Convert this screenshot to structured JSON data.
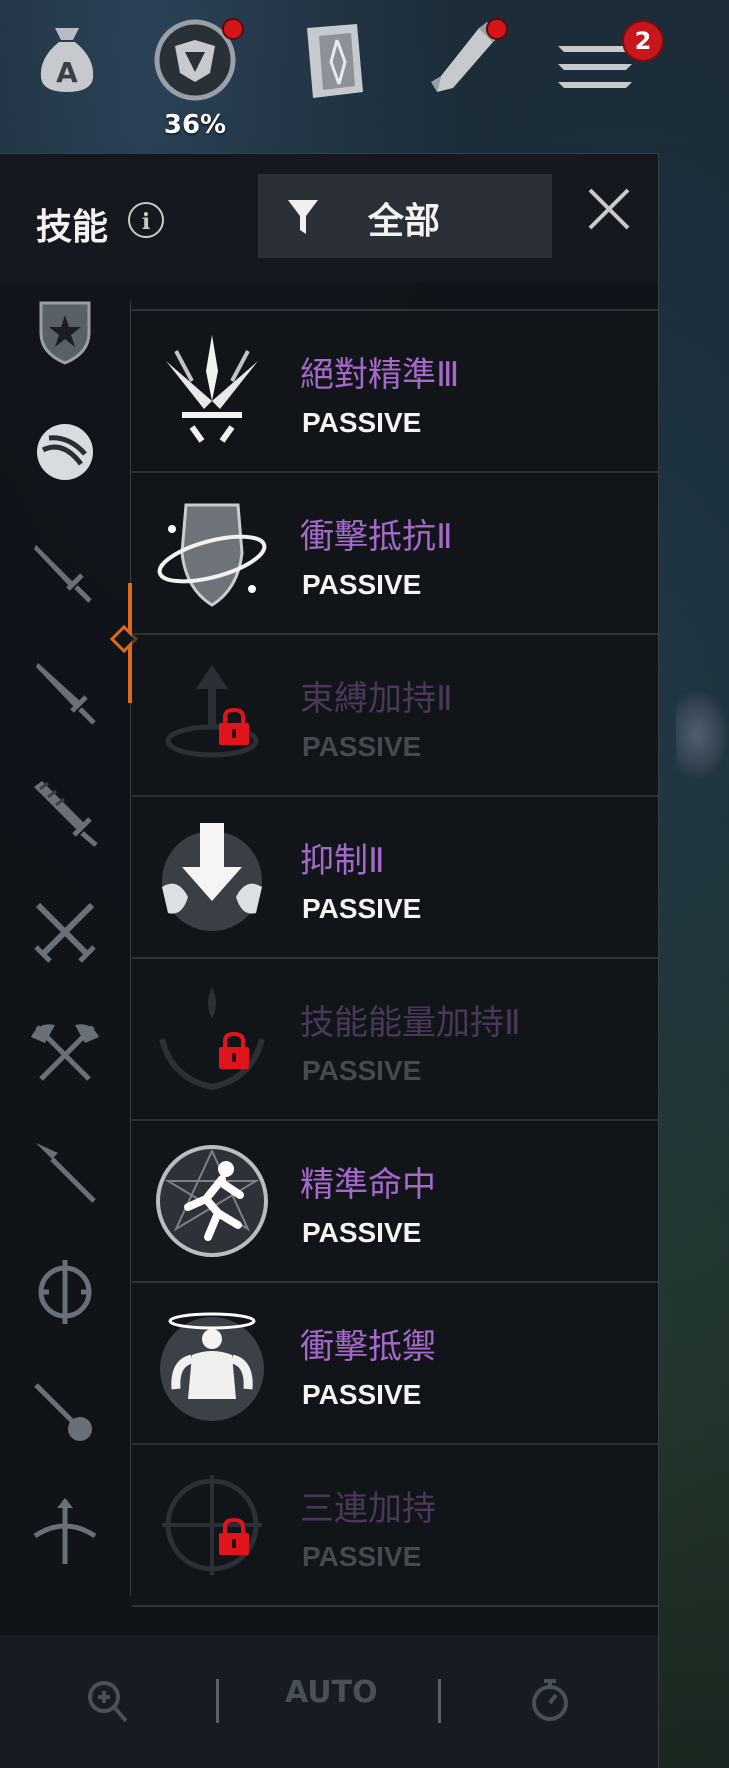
{
  "topbar": {
    "progress_percent": "36%",
    "menu_badge": "2"
  },
  "panel": {
    "title": "技能",
    "info_glyph": "i",
    "filter_label": "全部"
  },
  "sidebar": {
    "categories": [
      {
        "icon": "shield-emblem-icon"
      },
      {
        "icon": "orb-icon",
        "selected": true
      },
      {
        "icon": "dagger-icon"
      },
      {
        "icon": "sword-icon"
      },
      {
        "icon": "greatsword-icon"
      },
      {
        "icon": "crossed-swords-icon"
      },
      {
        "icon": "crossed-axes-icon"
      },
      {
        "icon": "spear-icon"
      },
      {
        "icon": "crest-icon"
      },
      {
        "icon": "mace-icon"
      },
      {
        "icon": "crossbow-icon"
      }
    ]
  },
  "skills": [
    {
      "name": "絕對精準Ⅲ",
      "type": "PASSIVE",
      "locked": false,
      "icon": "crossed-blades-icon"
    },
    {
      "name": "衝擊抵抗Ⅱ",
      "type": "PASSIVE",
      "locked": false,
      "icon": "shield-orbit-icon"
    },
    {
      "name": "束縛加持Ⅱ",
      "type": "PASSIVE",
      "locked": true,
      "icon": "bind-icon"
    },
    {
      "name": "抑制Ⅱ",
      "type": "PASSIVE",
      "locked": false,
      "icon": "down-arrow-fists-icon"
    },
    {
      "name": "技能能量加持Ⅱ",
      "type": "PASSIVE",
      "locked": true,
      "icon": "energy-hands-icon"
    },
    {
      "name": "精準命中",
      "type": "PASSIVE",
      "locked": false,
      "icon": "runner-icon"
    },
    {
      "name": "衝擊抵禦",
      "type": "PASSIVE",
      "locked": false,
      "icon": "strongman-icon"
    },
    {
      "name": "三連加持",
      "type": "PASSIVE",
      "locked": true,
      "icon": "triple-icon"
    }
  ],
  "footer": {
    "auto_label": "AUTO"
  },
  "colors": {
    "skill_name": "#a569c9",
    "skill_name_locked": "#4a3858",
    "accent": "#e06a1c",
    "lock_red": "#e0151b"
  }
}
